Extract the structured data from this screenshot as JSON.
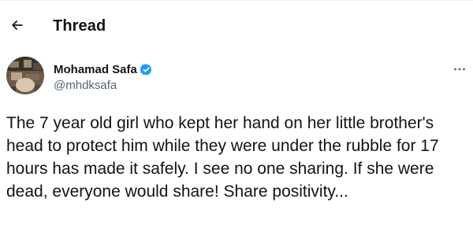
{
  "header": {
    "title": "Thread",
    "back_icon": "arrow-left-icon"
  },
  "author": {
    "display_name": "Mohamad Safa",
    "handle": "@mhdksafa",
    "verified_icon": "verified-badge-icon",
    "verified_color": "#1d9bf0"
  },
  "tweet": {
    "text": "The 7 year old girl who kept her hand on her little brother's head to protect him while they were under the rubble for 17 hours has made it safely. I see no one sharing. If she were dead, everyone would share! Share positivity..."
  },
  "actions": {
    "more_icon": "more-horizontal-icon"
  }
}
